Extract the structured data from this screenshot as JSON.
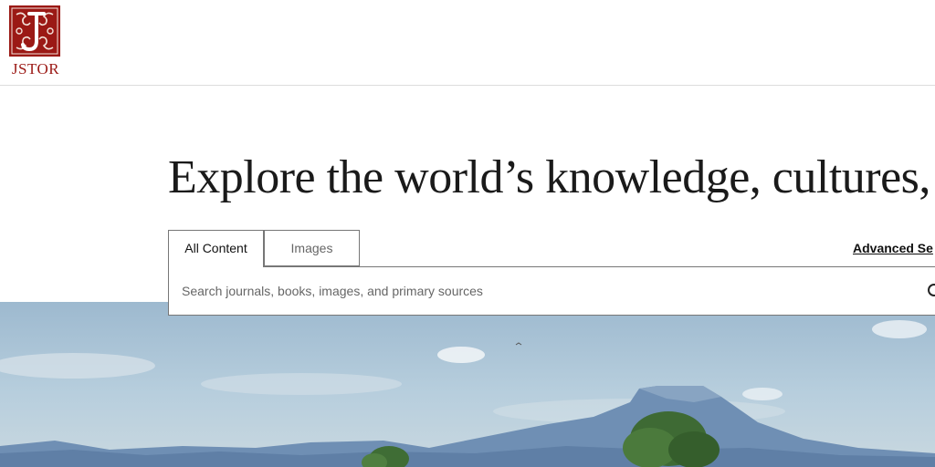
{
  "header": {
    "logo_text": "JSTOR",
    "brand_color": "#9b1915"
  },
  "hero": {
    "title": "Explore the world’s knowledge, cultures,"
  },
  "search": {
    "tabs": [
      {
        "label": "All Content",
        "active": true
      },
      {
        "label": "Images",
        "active": false
      }
    ],
    "advanced_label": "Advanced Se",
    "placeholder": "Search journals, books, images, and primary sources",
    "value": "",
    "icon": "search-icon"
  },
  "colors": {
    "sky": "#a9c4d8",
    "mountain": "#6f8fb4",
    "tree": "#3e6a34"
  }
}
